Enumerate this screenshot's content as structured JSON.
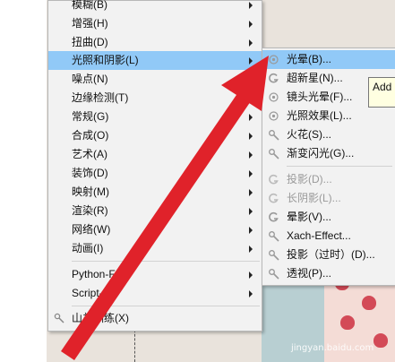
{
  "main_menu": {
    "items": [
      {
        "label": "模糊(B)",
        "arrow": true
      },
      {
        "label": "增强(H)",
        "arrow": true
      },
      {
        "label": "扭曲(D)",
        "arrow": true
      },
      {
        "label": "光照和阴影(L)",
        "arrow": true,
        "highlighted": true
      },
      {
        "label": "噪点(N)",
        "arrow": true
      },
      {
        "label": "边缘检测(T)",
        "arrow": true
      },
      {
        "label": "常规(G)",
        "arrow": true
      },
      {
        "label": "合成(O)",
        "arrow": true
      },
      {
        "label": "艺术(A)",
        "arrow": true
      },
      {
        "label": "装饰(D)",
        "arrow": true
      },
      {
        "label": "映射(M)",
        "arrow": true
      },
      {
        "label": "渲染(R)",
        "arrow": true
      },
      {
        "label": "网络(W)",
        "arrow": true
      },
      {
        "label": "动画(I)",
        "arrow": true
      },
      {
        "label": "Python-Fu",
        "arrow": true
      },
      {
        "label": "Script-Fu",
        "arrow": true
      },
      {
        "label": "山羊训练(X)",
        "arrow": false
      }
    ]
  },
  "sub_menu": {
    "items": [
      {
        "label": "光晕(B)...",
        "highlighted": true,
        "icon": "flare-icon"
      },
      {
        "label": "超新星(N)...",
        "icon": "gimp-g-icon"
      },
      {
        "label": "镜头光晕(F)...",
        "icon": "flare-icon"
      },
      {
        "label": "光照效果(L)...",
        "icon": "flare-icon"
      },
      {
        "label": "火花(S)...",
        "icon": "plugin-icon"
      },
      {
        "label": "渐变闪光(G)...",
        "icon": "plugin-icon"
      },
      {
        "label": "投影(D)...",
        "disabled": true,
        "icon": "gimp-g-icon"
      },
      {
        "label": "长阴影(L)...",
        "disabled": true,
        "icon": "gimp-g-icon"
      },
      {
        "label": "晕影(V)...",
        "icon": "gimp-g-icon"
      },
      {
        "label": "Xach-Effect...",
        "icon": "plugin-icon"
      },
      {
        "label": "投影（过时）(D)...",
        "icon": "plugin-icon"
      },
      {
        "label": "透视(P)...",
        "icon": "plugin-icon"
      }
    ]
  },
  "tooltip": {
    "text": "Add"
  },
  "watermark": {
    "text": "jingyan.baidu.com"
  },
  "colors": {
    "highlight": "#91c9f7",
    "arrow": "#e0222a",
    "menu_bg": "#f2f2f2"
  }
}
